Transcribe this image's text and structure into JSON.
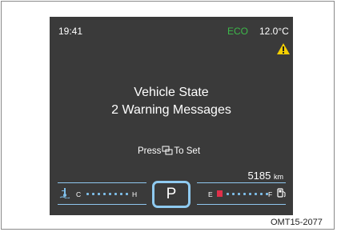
{
  "status_bar": {
    "time": "19:41",
    "mode": "ECO",
    "outside_temp": "12.0°C"
  },
  "message": {
    "title": "Vehicle State",
    "subtitle": "2 Warning Messages"
  },
  "hint": {
    "prefix": "Press",
    "suffix": "To Set"
  },
  "odometer": {
    "value": "5185",
    "unit": "km"
  },
  "temp_gauge": {
    "low": "C",
    "high": "H"
  },
  "gear": "P",
  "fuel_gauge": {
    "low": "E",
    "high": "F"
  },
  "colors": {
    "eco": "#3db84a",
    "warning": "#f5d000",
    "fuel_low": "#e0304a",
    "accent": "#8fcaf0"
  },
  "caption": "OMT15-2077"
}
